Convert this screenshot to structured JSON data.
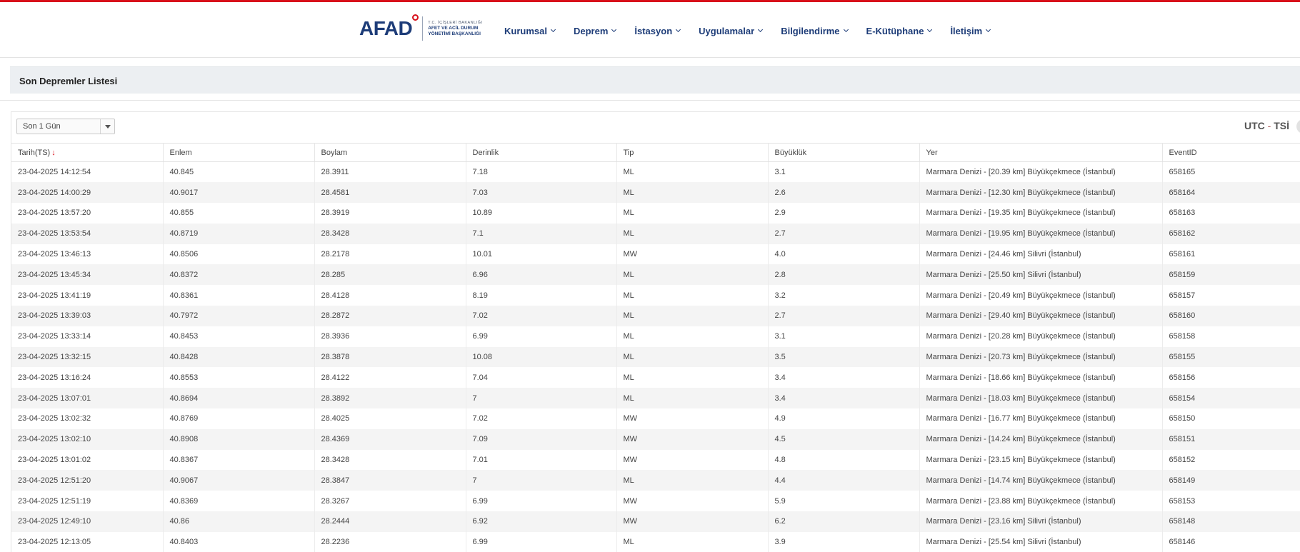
{
  "logo": {
    "mark": "AFAD",
    "line1": "T.C. İÇİŞLERİ BAKANLIĞI",
    "line2": "AFET VE ACİL DURUM",
    "line3": "YÖNETİMİ BAŞKANLIĞI"
  },
  "nav": [
    "Kurumsal",
    "Deprem",
    "İstasyon",
    "Uygulamalar",
    "Bilgilendirme",
    "E-Kütüphane",
    "İletişim"
  ],
  "page_title": "Son Depremler Listesi",
  "filter": {
    "selected": "Son 1 Gün"
  },
  "timezone": {
    "utc": "UTC",
    "sep": "-",
    "tsi": "TSİ"
  },
  "table": {
    "headers": [
      "Tarih(TS)",
      "Enlem",
      "Boylam",
      "Derinlik",
      "Tip",
      "Büyüklük",
      "Yer",
      "EventID"
    ],
    "sort_icon": "sort-down-arrow",
    "rows": [
      [
        "23-04-2025 14:12:54",
        "40.845",
        "28.3911",
        "7.18",
        "ML",
        "3.1",
        "Marmara Denizi - [20.39 km] Büyükçekmece (İstanbul)",
        "658165"
      ],
      [
        "23-04-2025 14:00:29",
        "40.9017",
        "28.4581",
        "7.03",
        "ML",
        "2.6",
        "Marmara Denizi - [12.30 km] Büyükçekmece (İstanbul)",
        "658164"
      ],
      [
        "23-04-2025 13:57:20",
        "40.855",
        "28.3919",
        "10.89",
        "ML",
        "2.9",
        "Marmara Denizi - [19.35 km] Büyükçekmece (İstanbul)",
        "658163"
      ],
      [
        "23-04-2025 13:53:54",
        "40.8719",
        "28.3428",
        "7.1",
        "ML",
        "2.7",
        "Marmara Denizi - [19.95 km] Büyükçekmece (İstanbul)",
        "658162"
      ],
      [
        "23-04-2025 13:46:13",
        "40.8506",
        "28.2178",
        "10.01",
        "MW",
        "4.0",
        "Marmara Denizi - [24.46 km] Silivri (İstanbul)",
        "658161"
      ],
      [
        "23-04-2025 13:45:34",
        "40.8372",
        "28.285",
        "6.96",
        "ML",
        "2.8",
        "Marmara Denizi - [25.50 km] Silivri (İstanbul)",
        "658159"
      ],
      [
        "23-04-2025 13:41:19",
        "40.8361",
        "28.4128",
        "8.19",
        "ML",
        "3.2",
        "Marmara Denizi - [20.49 km] Büyükçekmece (İstanbul)",
        "658157"
      ],
      [
        "23-04-2025 13:39:03",
        "40.7972",
        "28.2872",
        "7.02",
        "ML",
        "2.7",
        "Marmara Denizi - [29.40 km] Büyükçekmece (İstanbul)",
        "658160"
      ],
      [
        "23-04-2025 13:33:14",
        "40.8453",
        "28.3936",
        "6.99",
        "ML",
        "3.1",
        "Marmara Denizi - [20.28 km] Büyükçekmece (İstanbul)",
        "658158"
      ],
      [
        "23-04-2025 13:32:15",
        "40.8428",
        "28.3878",
        "10.08",
        "ML",
        "3.5",
        "Marmara Denizi - [20.73 km] Büyükçekmece (İstanbul)",
        "658155"
      ],
      [
        "23-04-2025 13:16:24",
        "40.8553",
        "28.4122",
        "7.04",
        "ML",
        "3.4",
        "Marmara Denizi - [18.66 km] Büyükçekmece (İstanbul)",
        "658156"
      ],
      [
        "23-04-2025 13:07:01",
        "40.8694",
        "28.3892",
        "7",
        "ML",
        "3.4",
        "Marmara Denizi - [18.03 km] Büyükçekmece (İstanbul)",
        "658154"
      ],
      [
        "23-04-2025 13:02:32",
        "40.8769",
        "28.4025",
        "7.02",
        "MW",
        "4.9",
        "Marmara Denizi - [16.77 km] Büyükçekmece (İstanbul)",
        "658150"
      ],
      [
        "23-04-2025 13:02:10",
        "40.8908",
        "28.4369",
        "7.09",
        "MW",
        "4.5",
        "Marmara Denizi - [14.24 km] Büyükçekmece (İstanbul)",
        "658151"
      ],
      [
        "23-04-2025 13:01:02",
        "40.8367",
        "28.3428",
        "7.01",
        "MW",
        "4.8",
        "Marmara Denizi - [23.15 km] Büyükçekmece (İstanbul)",
        "658152"
      ],
      [
        "23-04-2025 12:51:20",
        "40.9067",
        "28.3847",
        "7",
        "ML",
        "4.4",
        "Marmara Denizi - [14.74 km] Büyükçekmece (İstanbul)",
        "658149"
      ],
      [
        "23-04-2025 12:51:19",
        "40.8369",
        "28.3267",
        "6.99",
        "MW",
        "5.9",
        "Marmara Denizi - [23.88 km] Büyükçekmece (İstanbul)",
        "658153"
      ],
      [
        "23-04-2025 12:49:10",
        "40.86",
        "28.2444",
        "6.92",
        "MW",
        "6.2",
        "Marmara Denizi - [23.16 km] Silivri (İstanbul)",
        "658148"
      ],
      [
        "23-04-2025 12:13:05",
        "40.8403",
        "28.2236",
        "6.99",
        "ML",
        "3.9",
        "Marmara Denizi - [25.54 km] Silivri (İstanbul)",
        "658146"
      ]
    ]
  },
  "colors": {
    "accent_red": "#d8101a",
    "brand_blue": "#1d3c78"
  }
}
